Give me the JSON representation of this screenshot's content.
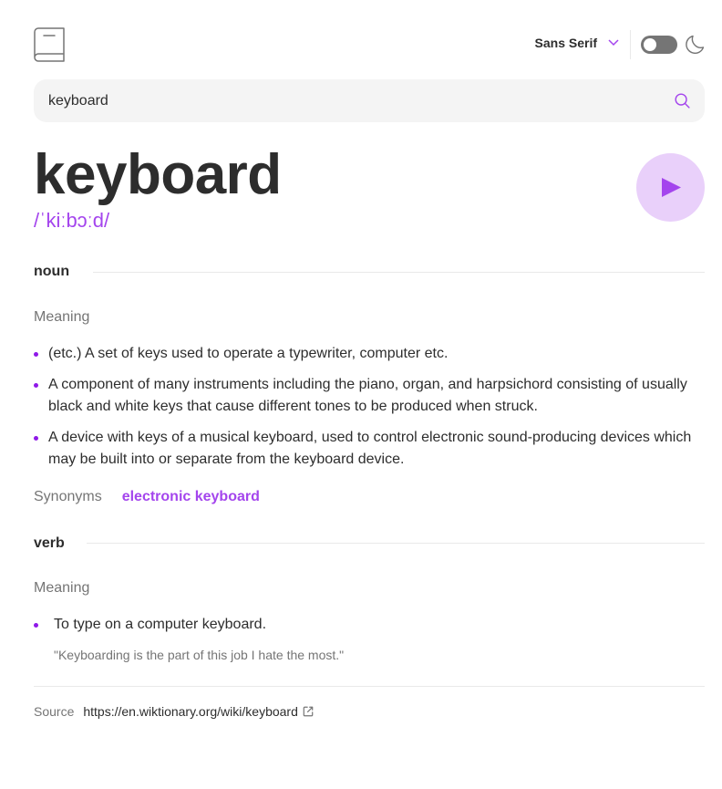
{
  "header": {
    "logo_icon": "book-icon",
    "font_select": {
      "value": "Sans Serif",
      "icon": "chevron-down-icon"
    },
    "theme_toggle": {
      "state": "off",
      "icon": "moon-icon"
    }
  },
  "search": {
    "value": "keyboard",
    "icon": "search-icon"
  },
  "entry": {
    "word": "keyboard",
    "phonetic": "/ˈkiːbɔːd/",
    "play_icon": "play-icon"
  },
  "noun": {
    "label": "noun",
    "meaning_label": "Meaning",
    "definitions": [
      " (etc.) A set of keys used to operate a typewriter, computer etc.",
      " A component of many instruments including the piano, organ, and harpsichord consisting of usually black and white keys that cause different tones to be produced when struck.",
      " A device with keys of a musical keyboard, used to control electronic sound-producing devices which may be built into or separate from the keyboard device."
    ],
    "synonyms_label": "Synonyms",
    "synonyms": "electronic keyboard"
  },
  "verb": {
    "label": "verb",
    "meaning_label": "Meaning",
    "definitions": [
      "To type on a computer keyboard."
    ],
    "example": "\"Keyboarding is the part of this job I hate the most.\""
  },
  "source": {
    "label": "Source",
    "url": "https://en.wiktionary.org/wiki/keyboard",
    "icon": "external-link-icon"
  },
  "colors": {
    "accent": "#a445ed",
    "bullet": "#8f19e8",
    "play_bg": "#e9d0fa",
    "text": "#2d2d2d",
    "muted": "#757575"
  }
}
